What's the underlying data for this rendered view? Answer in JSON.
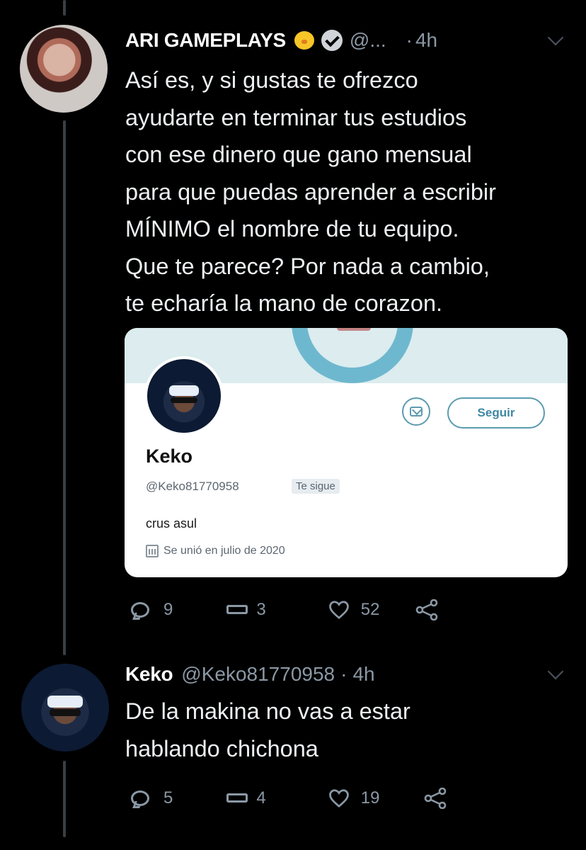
{
  "tweet1": {
    "author_name": "ARI GAMEPLAYS",
    "emoji": "🐥",
    "handle": "@...",
    "separator": "·",
    "time": "4h",
    "text_lines": [
      "Así es, y si gustas te ofrezco",
      "ayudarte en terminar tus estudios",
      "con ese dinero que gano mensual",
      "para que puedas aprender a escribir",
      "MÍNIMO el nombre de tu equipo.",
      "Que te parece? Por nada a cambio,",
      "te echaría la mano de corazon."
    ],
    "counts": {
      "replies": "9",
      "retweets": "3",
      "likes": "52"
    }
  },
  "card": {
    "follow_label": "Seguir",
    "name": "Keko",
    "handle": "@Keko81770958",
    "follows_you": "Te sigue",
    "bio": "crus asul",
    "joined": "Se unió en julio de 2020"
  },
  "tweet2": {
    "author_name": "Keko",
    "handle": "@Keko81770958",
    "separator": "·",
    "time": "4h",
    "text_lines": [
      "De la makina no vas a estar",
      "hablando chichona"
    ],
    "counts": {
      "replies": "5",
      "retweets": "4",
      "likes": "19"
    }
  },
  "colors": {
    "background": "#000000",
    "text": "#e7e9ea",
    "muted": "#8b98a5",
    "accent": "#5c9bb0"
  }
}
